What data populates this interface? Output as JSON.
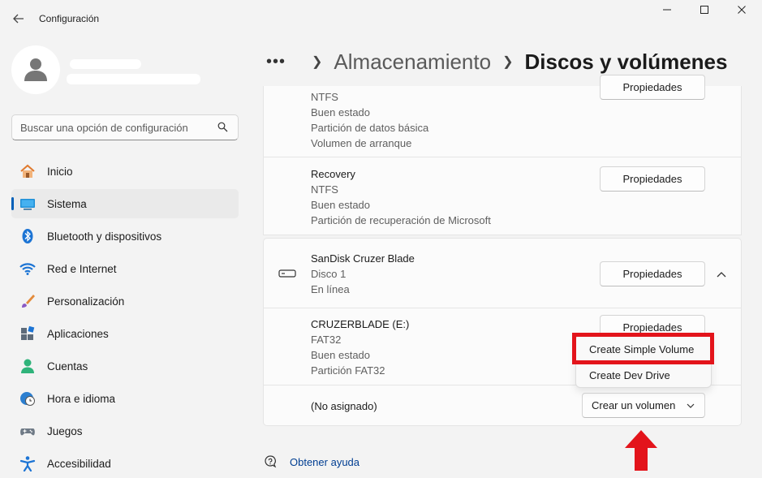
{
  "window": {
    "title": "Configuración"
  },
  "search": {
    "placeholder": "Buscar una opción de configuración"
  },
  "nav": [
    {
      "label": "Inicio",
      "icon": "home-icon"
    },
    {
      "label": "Sistema",
      "icon": "system-icon",
      "active": true
    },
    {
      "label": "Bluetooth y dispositivos",
      "icon": "bluetooth-icon"
    },
    {
      "label": "Red e Internet",
      "icon": "wifi-icon"
    },
    {
      "label": "Personalización",
      "icon": "brush-icon"
    },
    {
      "label": "Aplicaciones",
      "icon": "apps-icon"
    },
    {
      "label": "Cuentas",
      "icon": "account-icon"
    },
    {
      "label": "Hora e idioma",
      "icon": "clock-globe-icon"
    },
    {
      "label": "Juegos",
      "icon": "gamepad-icon"
    },
    {
      "label": "Accesibilidad",
      "icon": "accessibility-icon"
    }
  ],
  "breadcrumb": {
    "more": "•••",
    "parent": "Almacenamiento",
    "current": "Discos y volúmenes"
  },
  "disk0": {
    "partitions": [
      {
        "fs": "NTFS",
        "status": "Buen estado",
        "type": "Partición de datos básica",
        "extra": "Volumen de arranque",
        "button": "Propiedades"
      },
      {
        "name": "Recovery",
        "fs": "NTFS",
        "status": "Buen estado",
        "type": "Partición de recuperación de Microsoft",
        "button": "Propiedades"
      }
    ]
  },
  "disk1": {
    "name": "SanDisk Cruzer Blade",
    "number": "Disco 1",
    "state": "En línea",
    "button": "Propiedades",
    "volume": {
      "name": "CRUZERBLADE (E:)",
      "fs": "FAT32",
      "status": "Buen estado",
      "type": "Partición FAT32",
      "button": "Propiedades"
    },
    "unallocated": {
      "label": "(No asignado)",
      "button": "Crear un volumen"
    }
  },
  "menu": {
    "items": [
      "Create Simple Volume",
      "Create Dev Drive"
    ]
  },
  "help": {
    "label": "Obtener ayuda"
  },
  "colors": {
    "accent": "#005fb8",
    "highlight": "#e3141b"
  }
}
